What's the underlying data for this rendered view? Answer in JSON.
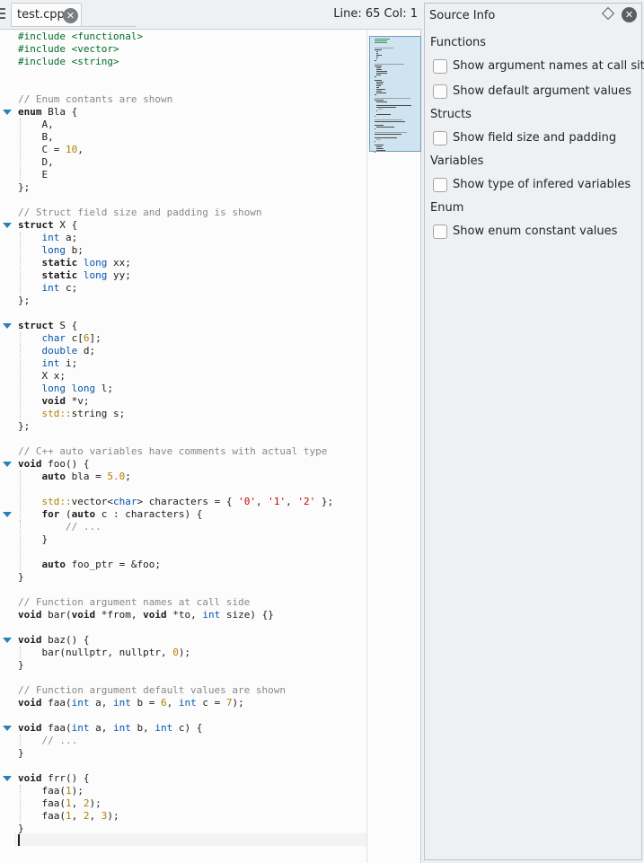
{
  "tab": {
    "filename": "test.cpp",
    "close_icon": "close-icon"
  },
  "status": {
    "cursor_position": "Line: 65 Col: 1"
  },
  "panel": {
    "title": "Source Info",
    "sections": [
      {
        "heading": "Functions",
        "options": [
          {
            "label": "Show argument names at call site",
            "checked": false
          },
          {
            "label": "Show default argument values",
            "checked": false
          }
        ]
      },
      {
        "heading": "Structs",
        "options": [
          {
            "label": "Show field size and padding",
            "checked": false
          }
        ]
      },
      {
        "heading": "Variables",
        "options": [
          {
            "label": "Show type of infered variables",
            "checked": false
          }
        ]
      },
      {
        "heading": "Enum",
        "options": [
          {
            "label": "Show enum constant values",
            "checked": false
          }
        ]
      }
    ]
  },
  "code": {
    "lines": [
      "#include <functional>",
      "#include <vector>",
      "#include <string>",
      "",
      "",
      "// Enum contants are shown",
      "enum Bla {",
      "    A,",
      "    B,",
      "    C = 10,",
      "    D,",
      "    E",
      "};",
      "",
      "// Struct field size and padding is shown",
      "struct X {",
      "    int a;",
      "    long b;",
      "    static long xx;",
      "    static long yy;",
      "    int c;",
      "};",
      "",
      "struct S {",
      "    char c[6];",
      "    double d;",
      "    int i;",
      "    X x;",
      "    long long l;",
      "    void *v;",
      "    std::string s;",
      "};",
      "",
      "// C++ auto variables have comments with actual type",
      "void foo() {",
      "    auto bla = 5.0;",
      "",
      "    std::vector<char> characters = { '0', '1', '2' };",
      "    for (auto c : characters) {",
      "        // ...",
      "    }",
      "",
      "    auto foo_ptr = &foo;",
      "}",
      "",
      "// Function argument names at call side",
      "void bar(void *from, void *to, int size) {}",
      "",
      "void baz() {",
      "    bar(nullptr, nullptr, 0);",
      "}",
      "",
      "// Function argument default values are shown",
      "void faa(int a, int b = 6, int c = 7);",
      "",
      "void faa(int a, int b, int c) {",
      "    // ...",
      "}",
      "",
      "void frr() {",
      "    faa(1);",
      "    faa(1, 2);",
      "    faa(1, 2, 3);",
      "}",
      ""
    ]
  },
  "colors": {
    "accent": "#2980b9",
    "comment": "#898887",
    "preprocessor": "#006e28",
    "number": "#b08000",
    "type": "#0057ae"
  }
}
